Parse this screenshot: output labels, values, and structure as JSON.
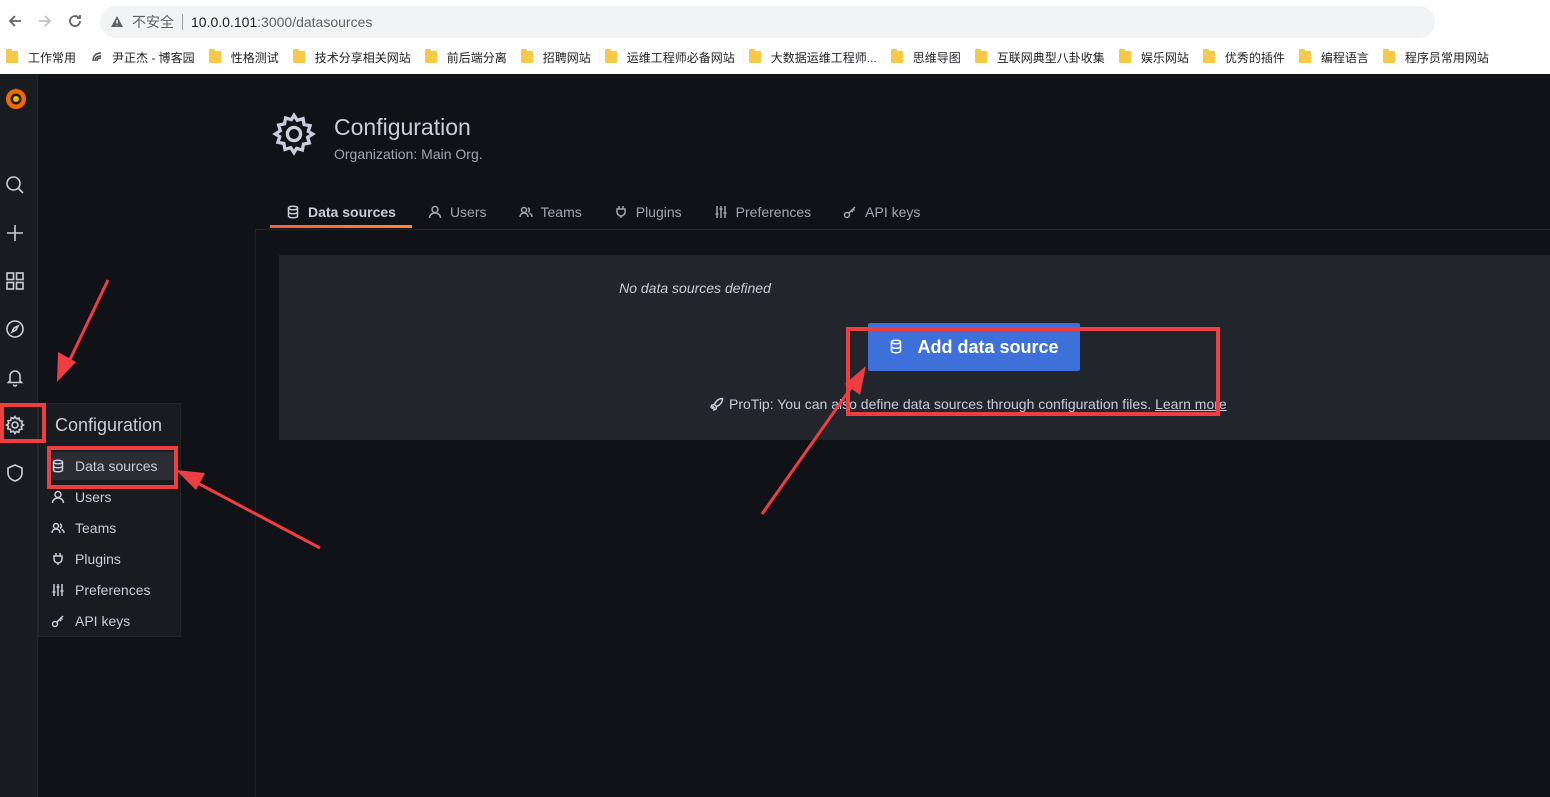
{
  "browser": {
    "insecure_label": "不安全",
    "url_host": "10.0.0.101",
    "url_path": ":3000/datasources",
    "bookmarks": [
      {
        "label": "工作常用",
        "type": "folder"
      },
      {
        "label": "尹正杰 - 博客园",
        "type": "site"
      },
      {
        "label": "性格测试",
        "type": "folder"
      },
      {
        "label": "技术分享相关网站",
        "type": "folder"
      },
      {
        "label": "前后端分离",
        "type": "folder"
      },
      {
        "label": "招聘网站",
        "type": "folder"
      },
      {
        "label": "运维工程师必备网站",
        "type": "folder"
      },
      {
        "label": "大数据运维工程师...",
        "type": "folder"
      },
      {
        "label": "思维导图",
        "type": "folder"
      },
      {
        "label": "互联网典型八卦收集",
        "type": "folder"
      },
      {
        "label": "娱乐网站",
        "type": "folder"
      },
      {
        "label": "优秀的插件",
        "type": "folder"
      },
      {
        "label": "编程语言",
        "type": "folder"
      },
      {
        "label": "程序员常用网站",
        "type": "folder"
      }
    ]
  },
  "flyout": {
    "title": "Configuration",
    "items": [
      {
        "label": "Data sources",
        "icon": "database-icon"
      },
      {
        "label": "Users",
        "icon": "user-icon"
      },
      {
        "label": "Teams",
        "icon": "users-icon"
      },
      {
        "label": "Plugins",
        "icon": "plug-icon"
      },
      {
        "label": "Preferences",
        "icon": "sliders-icon"
      },
      {
        "label": "API keys",
        "icon": "key-icon"
      }
    ]
  },
  "header": {
    "title": "Configuration",
    "subtitle": "Organization: Main Org."
  },
  "tabs": [
    {
      "label": "Data sources",
      "active": true
    },
    {
      "label": "Users"
    },
    {
      "label": "Teams"
    },
    {
      "label": "Plugins"
    },
    {
      "label": "Preferences"
    },
    {
      "label": "API keys"
    }
  ],
  "empty": {
    "message": "No data sources defined",
    "button_label": "Add data source",
    "protip": "ProTip: You can also define data sources through configuration files.",
    "learn_more": "Learn more"
  },
  "colors": {
    "accent_blue": "#3d71d9",
    "annotation_red": "#ef3e42",
    "tab_underline": "#f55f3e"
  }
}
